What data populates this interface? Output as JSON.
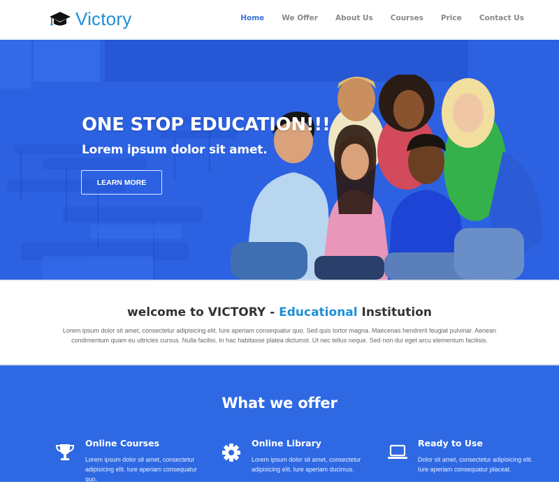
{
  "header": {
    "brand": "Victory",
    "logo_icon": "graduation-cap-icon",
    "nav": [
      {
        "label": "Home",
        "active": true
      },
      {
        "label": "We Offer",
        "active": false
      },
      {
        "label": "About Us",
        "active": false
      },
      {
        "label": "Courses",
        "active": false
      },
      {
        "label": "Price",
        "active": false
      },
      {
        "label": "Contact Us",
        "active": false
      }
    ]
  },
  "hero": {
    "title": "ONE STOP EDUCATION!!!",
    "subtitle": "Lorem ipsum dolor sit amet.",
    "button_label": "LEARN MORE",
    "image_alt": "group of smiling students"
  },
  "welcome": {
    "title_prefix": "welcome to ",
    "title_brand": "VICTORY",
    "title_dash": " - ",
    "title_accent": "Educational",
    "title_suffix": " Institution",
    "text": "Lorem ipsum dolor sit amet, consectetur adipisicing elit. Iure aperiam consequatur quo. Sed quis tortor magna. Maecenas hendrerit feugiat pulvinar. Aenean condimentum quam eu ultricies cursus. Nulla facilisi. In hac habitasse platea dictumst. Ut nec tellus neque. Sed non dui eget arcu elementum facilisis."
  },
  "offer": {
    "title": "What we offer",
    "features": [
      {
        "icon": "trophy-icon",
        "title": "Online Courses",
        "text": "Lorem ipsum dolor sit amet, consectetur adipisicing elit. Iure aperiam consequatur quo."
      },
      {
        "icon": "gear-icon",
        "title": "Online Library",
        "text": "Lorem ipsum dolor sit amet, consectetur adipisicing elit. Iure aperiam ducimus."
      },
      {
        "icon": "laptop-icon",
        "title": "Ready to Use",
        "text": "Dolor sit amet, consectetur adipisicing elit. Iure aperiam consequatur placeat."
      }
    ]
  },
  "colors": {
    "brand": "#1e8fd8",
    "nav_active": "#3b73d9",
    "hero_blue": "#2f66e6",
    "offer_blue": "#2e69e3"
  }
}
